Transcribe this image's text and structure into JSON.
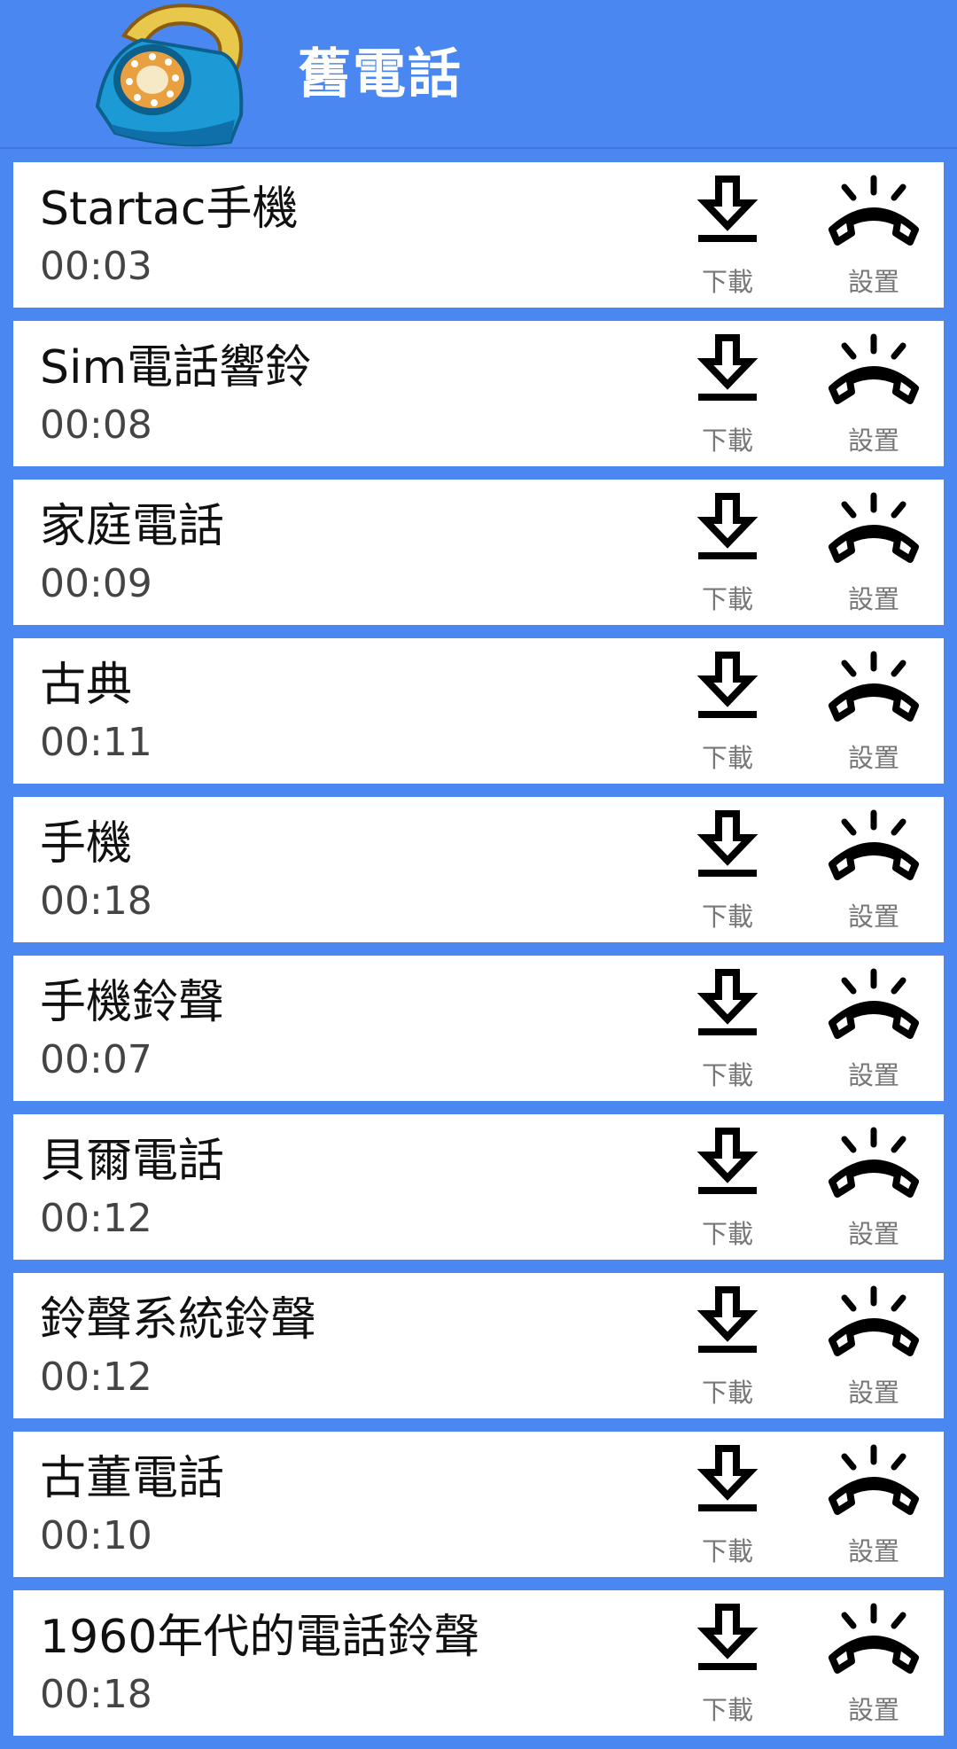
{
  "header": {
    "title": "舊電話",
    "logo_icon": "old-phone-logo"
  },
  "actions": {
    "download_label": "下載",
    "set_label": "設置"
  },
  "items": [
    {
      "name": "Startac手機",
      "duration": "00:03"
    },
    {
      "name": "Sim電話響鈴",
      "duration": "00:08"
    },
    {
      "name": "家庭電話",
      "duration": "00:09"
    },
    {
      "name": "古典",
      "duration": "00:11"
    },
    {
      "name": "手機",
      "duration": "00:18"
    },
    {
      "name": "手機鈴聲",
      "duration": "00:07"
    },
    {
      "name": "貝爾電話",
      "duration": "00:12"
    },
    {
      "name": "鈴聲系統鈴聲",
      "duration": "00:12"
    },
    {
      "name": "古董電話",
      "duration": "00:10"
    },
    {
      "name": "1960年代的電話鈴聲",
      "duration": "00:18"
    }
  ],
  "colors": {
    "background": "#4a87f0",
    "card": "#ffffff"
  }
}
